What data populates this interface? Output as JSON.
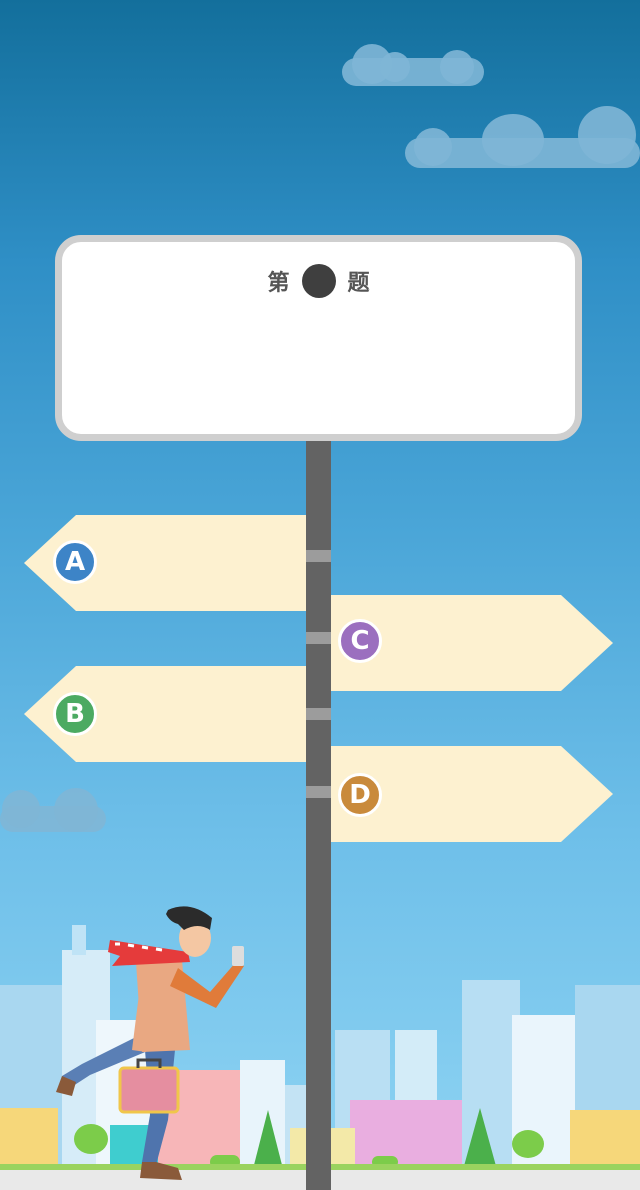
{
  "board": {
    "prefix": "第",
    "suffix": "题"
  },
  "options": [
    {
      "letter": "A",
      "color": "#3d84c7"
    },
    {
      "letter": "B",
      "color": "#4caa62"
    },
    {
      "letter": "C",
      "color": "#9b6fbf"
    },
    {
      "letter": "D",
      "color": "#c98a3b"
    }
  ],
  "colors": {
    "sky_top": "#136f9c",
    "sky_bottom": "#8fd4f3",
    "arrow_fill": "#fdf1d0",
    "pole": "#636363"
  }
}
